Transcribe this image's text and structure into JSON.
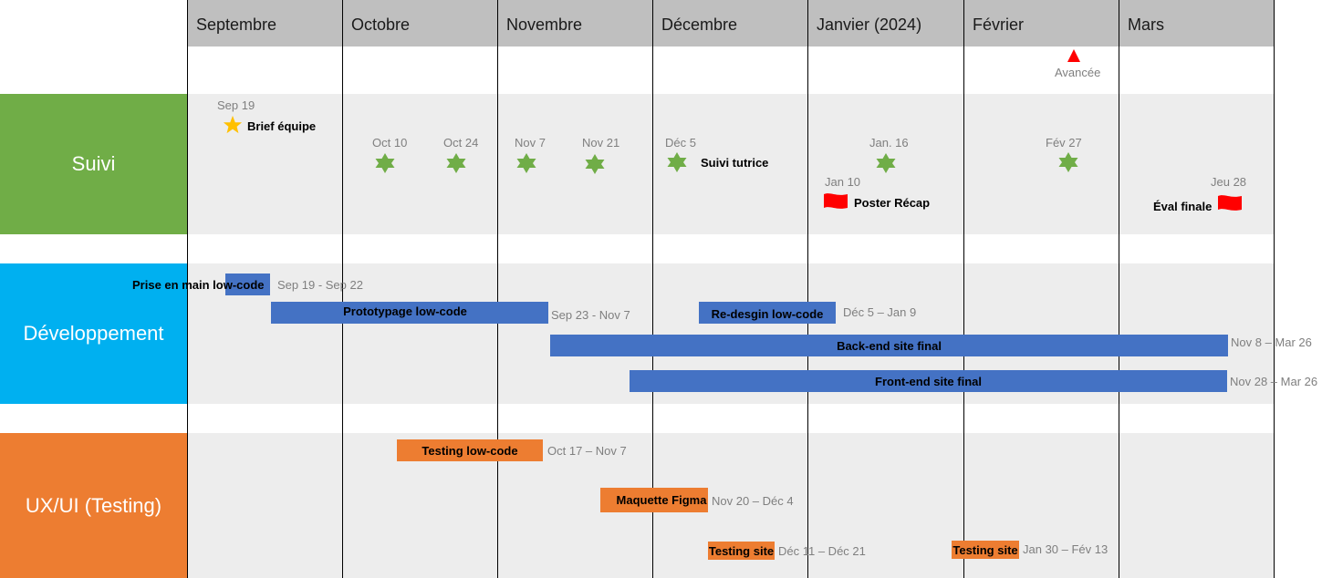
{
  "colors": {
    "header_bg": "#BFBFBF",
    "band_bg": "#EDEDED",
    "suivi": "#70AD47",
    "developpement": "#00B0F0",
    "ux": "#ED7D31",
    "task_blue": "#4472C4",
    "task_orange": "#ED7D31",
    "milestone_star_gold": "#FFC000",
    "milestone_star_green": "#70AD47",
    "flag_red": "#FF0000",
    "date_gray": "#7F7F7F"
  },
  "months": [
    "Septembre",
    "Octobre",
    "Novembre",
    "Décembre",
    "Janvier (2024)",
    "Février",
    "Mars"
  ],
  "today_marker": {
    "label": "Avancée",
    "icon": "triangle-up-icon"
  },
  "categories": [
    {
      "id": "suivi",
      "label": "Suivi"
    },
    {
      "id": "developpement",
      "label": "Développement"
    },
    {
      "id": "ux",
      "label": "UX/UI (Testing)"
    }
  ],
  "milestones": [
    {
      "date": "Sep 19",
      "label": "Brief équipe",
      "icon": "gold-star-icon"
    },
    {
      "date": "Oct 10",
      "label": "",
      "icon": "green-star-icon"
    },
    {
      "date": "Oct 24",
      "label": "",
      "icon": "green-star-icon"
    },
    {
      "date": "Nov 7",
      "label": "",
      "icon": "green-star-icon"
    },
    {
      "date": "Nov 21",
      "label": "",
      "icon": "green-star-icon"
    },
    {
      "date": "Déc 5",
      "label": "Suivi tutrice",
      "icon": "green-star-icon"
    },
    {
      "date": "Jan. 16",
      "label": "",
      "icon": "green-star-icon"
    },
    {
      "date": "Fév 27",
      "label": "",
      "icon": "green-star-icon"
    },
    {
      "date": "Jan 10",
      "label": "Poster Récap",
      "icon": "red-flag-icon"
    },
    {
      "date": "Jeu 28",
      "label": "Éval finale",
      "icon": "red-flag-icon"
    }
  ],
  "dev_tasks": [
    {
      "label": "Prise en main low-code",
      "dates": "Sep 19 -  Sep 22"
    },
    {
      "label": "Prototypage low-code",
      "dates": "Sep 23 -  Nov 7"
    },
    {
      "label": "Re-desgin low-code",
      "dates": "Déc 5 – Jan 9"
    },
    {
      "label": "Back-end site final",
      "dates": "Nov 8 – Mar 26"
    },
    {
      "label": "Front-end site final",
      "dates": "Nov 28 – Mar 26"
    }
  ],
  "ux_tasks": [
    {
      "label": "Testing low-code",
      "dates": "Oct 17 – Nov 7"
    },
    {
      "label": "Maquette Figma",
      "dates": "Nov 20 – Déc 4"
    },
    {
      "label": "Testing site",
      "dates": "Déc 11 – Déc 21"
    },
    {
      "label": "Testing site",
      "dates": "Jan 30 – Fév 13"
    }
  ]
}
